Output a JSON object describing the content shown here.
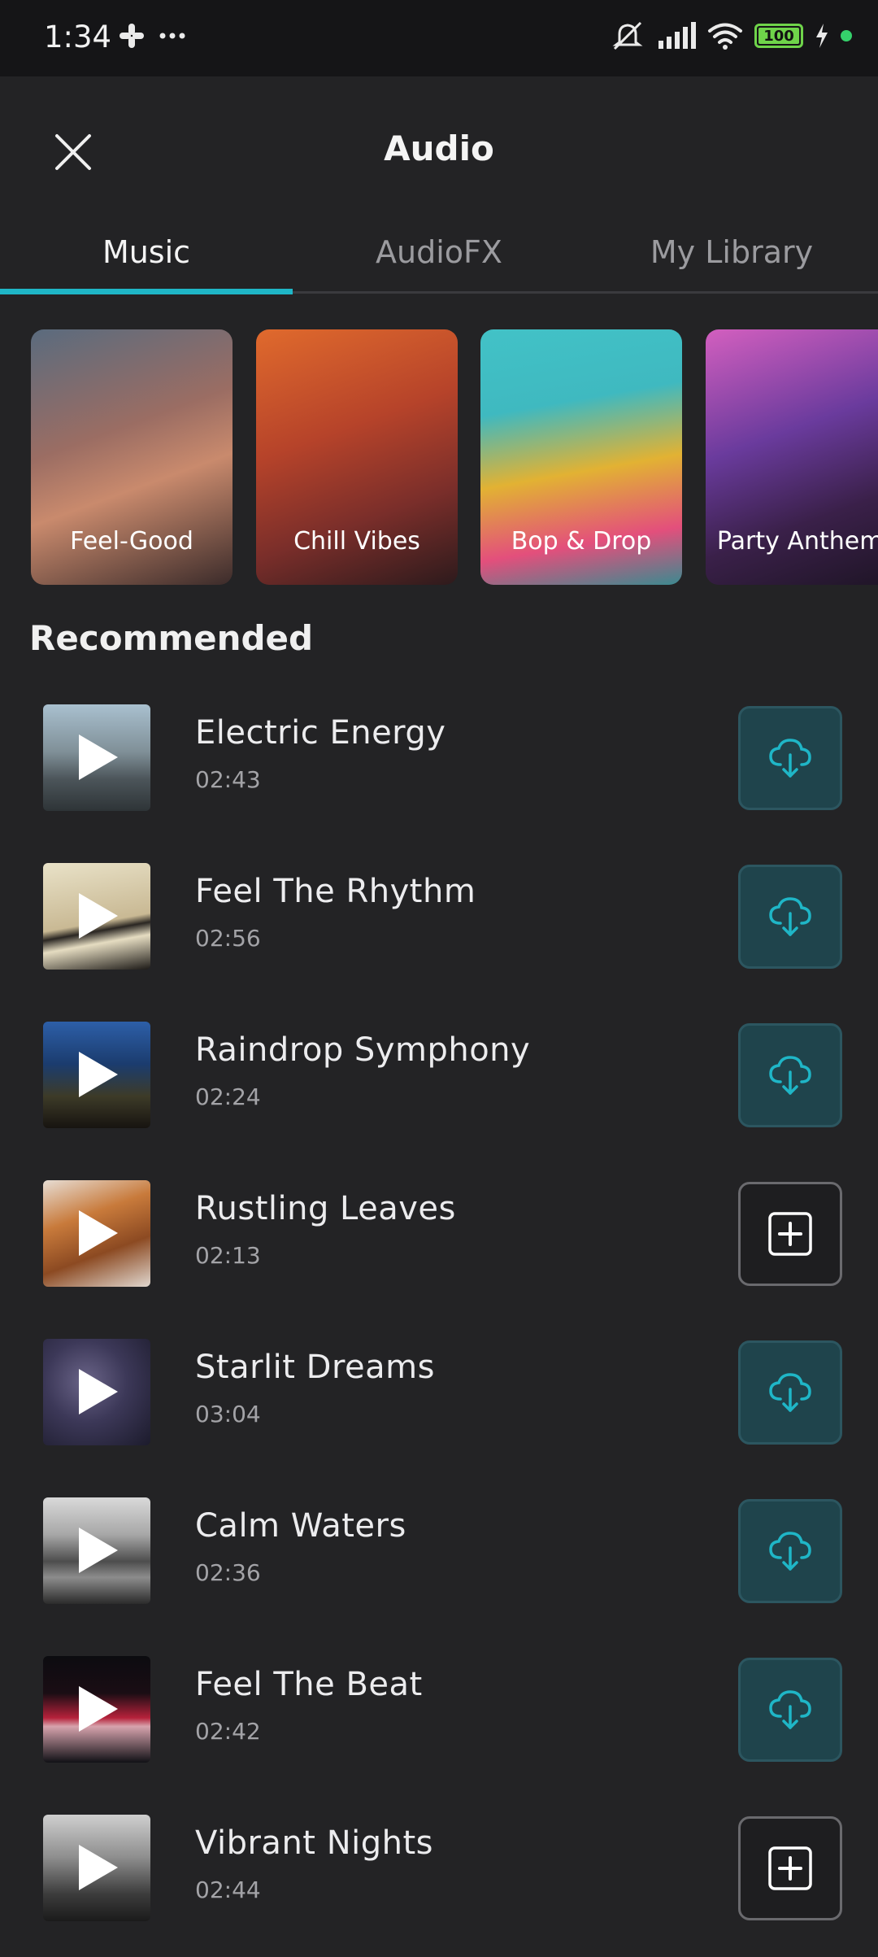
{
  "status_bar": {
    "time": "1:34",
    "battery": "100"
  },
  "header": {
    "title": "Audio"
  },
  "tabs": [
    {
      "label": "Music",
      "active": true
    },
    {
      "label": "AudioFX",
      "active": false
    },
    {
      "label": "My Library",
      "active": false
    }
  ],
  "categories": [
    {
      "label": "Feel-Good"
    },
    {
      "label": "Chill Vibes"
    },
    {
      "label": "Bop & Drop"
    },
    {
      "label": "Party Anthems"
    }
  ],
  "recommended_heading": "Recommended",
  "tracks": [
    {
      "title": "Electric Energy",
      "duration": "02:43",
      "action": "download-icon"
    },
    {
      "title": "Feel The Rhythm",
      "duration": "02:56",
      "action": "download-icon"
    },
    {
      "title": "Raindrop Symphony",
      "duration": "02:24",
      "action": "download-icon"
    },
    {
      "title": "Rustling Leaves",
      "duration": "02:13",
      "action": "add-icon"
    },
    {
      "title": "Starlit Dreams",
      "duration": "03:04",
      "action": "download-icon"
    },
    {
      "title": "Calm Waters",
      "duration": "02:36",
      "action": "download-icon"
    },
    {
      "title": "Feel The Beat",
      "duration": "02:42",
      "action": "download-icon"
    },
    {
      "title": "Vibrant Nights",
      "duration": "02:44",
      "action": "add-icon"
    }
  ],
  "colors": {
    "accent": "#1fb6c7",
    "background": "#232325",
    "download_bg": "#1f444c"
  }
}
